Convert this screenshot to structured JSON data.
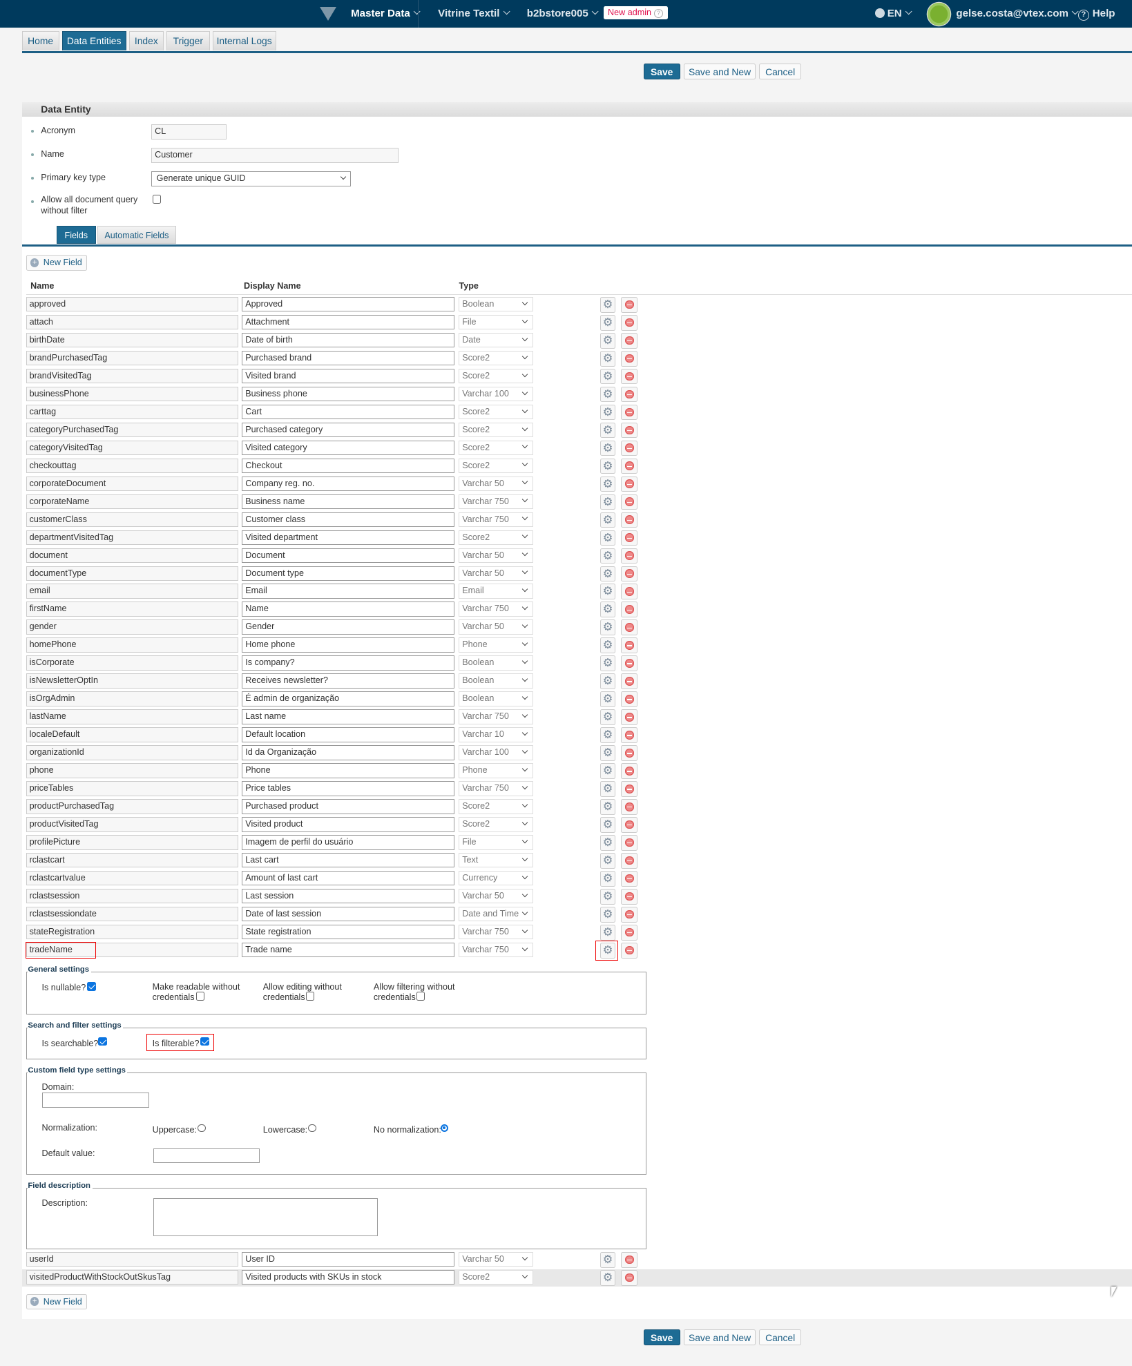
{
  "topbar": {
    "product": "Master Data",
    "store": "Vitrine Textil",
    "account": "b2bstore005",
    "new_admin": "New admin",
    "language": "EN",
    "user_email": "gelse.costa@vtex.com",
    "help": "Help"
  },
  "tabs": [
    "Home",
    "Data Entities",
    "Index",
    "Trigger",
    "Internal Logs"
  ],
  "active_tab": "Data Entities",
  "actions": {
    "save": "Save",
    "save_and_new": "Save and New",
    "cancel": "Cancel"
  },
  "entity": {
    "section_title": "Data Entity",
    "acronym_label": "Acronym",
    "acronym_value": "CL",
    "name_label": "Name",
    "name_value": "Customer",
    "pk_label": "Primary key type",
    "pk_value": "Generate unique GUID",
    "allow_query_label_1": "Allow all document query",
    "allow_query_label_2": "without filter",
    "allow_query_checked": false
  },
  "subtabs": [
    "Fields",
    "Automatic Fields"
  ],
  "new_field": "New Field",
  "columns": {
    "name": "Name",
    "display_name": "Display Name",
    "type": "Type"
  },
  "fields": [
    {
      "name": "approved",
      "display": "Approved",
      "type": "Boolean"
    },
    {
      "name": "attach",
      "display": "Attachment",
      "type": "File"
    },
    {
      "name": "birthDate",
      "display": "Date of birth",
      "type": "Date"
    },
    {
      "name": "brandPurchasedTag",
      "display": "Purchased brand",
      "type": "Score2"
    },
    {
      "name": "brandVisitedTag",
      "display": "Visited brand",
      "type": "Score2"
    },
    {
      "name": "businessPhone",
      "display": "Business phone",
      "type": "Varchar 100"
    },
    {
      "name": "carttag",
      "display": "Cart",
      "type": "Score2"
    },
    {
      "name": "categoryPurchasedTag",
      "display": "Purchased category",
      "type": "Score2"
    },
    {
      "name": "categoryVisitedTag",
      "display": "Visited category",
      "type": "Score2"
    },
    {
      "name": "checkouttag",
      "display": "Checkout",
      "type": "Score2"
    },
    {
      "name": "corporateDocument",
      "display": "Company reg. no.",
      "type": "Varchar 50"
    },
    {
      "name": "corporateName",
      "display": "Business name",
      "type": "Varchar 750"
    },
    {
      "name": "customerClass",
      "display": "Customer class",
      "type": "Varchar 750"
    },
    {
      "name": "departmentVisitedTag",
      "display": "Visited department",
      "type": "Score2"
    },
    {
      "name": "document",
      "display": "Document",
      "type": "Varchar 50"
    },
    {
      "name": "documentType",
      "display": "Document type",
      "type": "Varchar 50"
    },
    {
      "name": "email",
      "display": "Email",
      "type": "Email"
    },
    {
      "name": "firstName",
      "display": "Name",
      "type": "Varchar 750"
    },
    {
      "name": "gender",
      "display": "Gender",
      "type": "Varchar 50"
    },
    {
      "name": "homePhone",
      "display": "Home phone",
      "type": "Phone"
    },
    {
      "name": "isCorporate",
      "display": "Is company?",
      "type": "Boolean"
    },
    {
      "name": "isNewsletterOptIn",
      "display": "Receives newsletter?",
      "type": "Boolean"
    },
    {
      "name": "isOrgAdmin",
      "display": "É admin de organização",
      "type": "Boolean"
    },
    {
      "name": "lastName",
      "display": "Last name",
      "type": "Varchar 750"
    },
    {
      "name": "localeDefault",
      "display": "Default location",
      "type": "Varchar 10"
    },
    {
      "name": "organizationId",
      "display": "Id da Organização",
      "type": "Varchar 100"
    },
    {
      "name": "phone",
      "display": "Phone",
      "type": "Phone"
    },
    {
      "name": "priceTables",
      "display": "Price tables",
      "type": "Varchar 750"
    },
    {
      "name": "productPurchasedTag",
      "display": "Purchased product",
      "type": "Score2"
    },
    {
      "name": "productVisitedTag",
      "display": "Visited product",
      "type": "Score2"
    },
    {
      "name": "profilePicture",
      "display": "Imagem de perfil do usuário",
      "type": "File"
    },
    {
      "name": "rclastcart",
      "display": "Last cart",
      "type": "Text"
    },
    {
      "name": "rclastcartvalue",
      "display": "Amount of last cart",
      "type": "Currency"
    },
    {
      "name": "rclastsession",
      "display": "Last session",
      "type": "Varchar 50"
    },
    {
      "name": "rclastsessiondate",
      "display": "Date of last session",
      "type": "Date and Time"
    },
    {
      "name": "stateRegistration",
      "display": "State registration",
      "type": "Varchar 750"
    },
    {
      "name": "tradeName",
      "display": "Trade name",
      "type": "Varchar 750"
    }
  ],
  "fields_after": [
    {
      "name": "userId",
      "display": "User ID",
      "type": "Varchar 50"
    },
    {
      "name": "visitedProductWithStockOutSkusTag",
      "display": "Visited products with SKUs in stock",
      "type": "Score2"
    }
  ],
  "settings": {
    "general": {
      "legend": "General settings",
      "nullable": "Is nullable?",
      "nullable_checked": true,
      "readable_1": "Make readable without",
      "readable_2": "credentials",
      "readable_checked": false,
      "editing_1": "Allow editing without",
      "editing_2": "credentials",
      "editing_checked": false,
      "filtering_1": "Allow filtering without",
      "filtering_2": "credentials",
      "filtering_checked": false
    },
    "search": {
      "legend": "Search and filter settings",
      "searchable": "Is searchable?",
      "searchable_checked": true,
      "filterable": "Is filterable?",
      "filterable_checked": true
    },
    "custom": {
      "legend": "Custom field type settings",
      "domain": "Domain:",
      "domain_value": "",
      "normalization": "Normalization:",
      "uppercase": "Uppercase:",
      "lowercase": "Lowercase:",
      "none": "No normalization:",
      "selected": "none",
      "default_value": "Default value:",
      "default_value_value": ""
    },
    "description": {
      "legend": "Field description",
      "label": "Description:",
      "value": ""
    }
  }
}
